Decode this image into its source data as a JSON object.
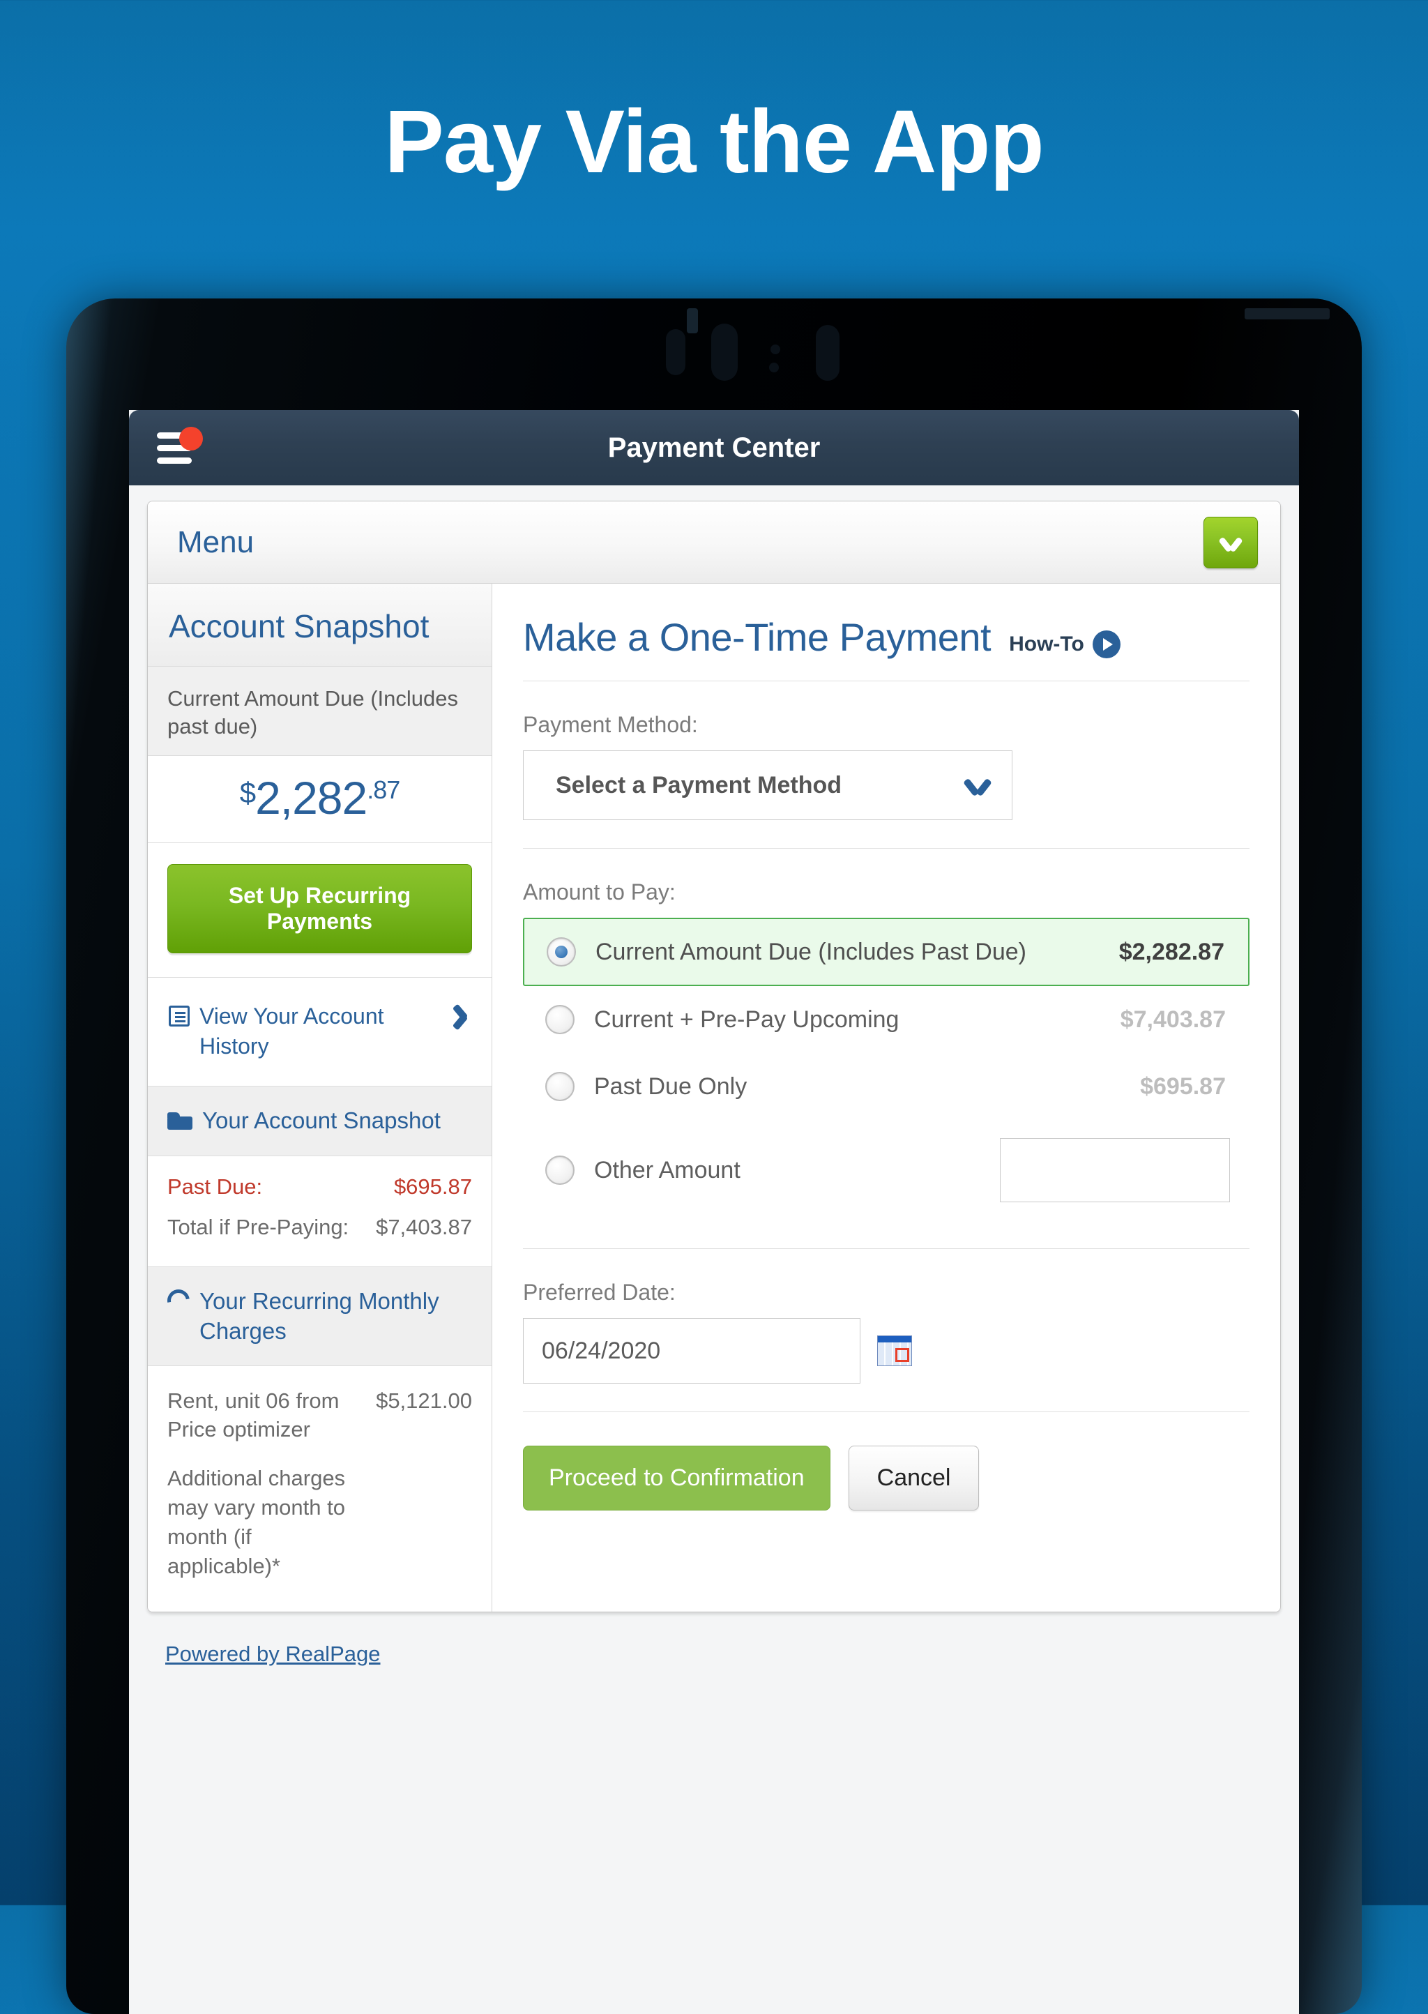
{
  "promo": {
    "headline": "Pay Via the App"
  },
  "appbar": {
    "title": "Payment Center",
    "menu_icon": "hamburger-icon",
    "badge_icon": "notification-dot"
  },
  "menu_strip": {
    "label": "Menu",
    "toggle_icon": "chevron-down-icon"
  },
  "sidebar": {
    "header_title": "Account Snapshot",
    "current_due_label": "Current Amount Due (Includes past due)",
    "current_due_currency": "$",
    "current_due_dollars": "2,282",
    "current_due_cents": ".87",
    "recurring_button": "Set Up Recurring Payments",
    "history_link": "View Your Account History",
    "history_icon": "list-icon",
    "history_chevron": "chevron-right-icon",
    "snapshot_section_title": "Your Account Snapshot",
    "snapshot_icon": "folder-icon",
    "snapshot_rows": [
      {
        "label": "Past Due:",
        "value": "$695.87"
      },
      {
        "label": "Total if Pre-Paying:",
        "value": "$7,403.87"
      }
    ],
    "recurring_section_title": "Your Recurring Monthly Charges",
    "recurring_icon": "refresh-icon",
    "charge_label": "Rent, unit 06 from Price optimizer",
    "charge_value": "$5,121.00",
    "charge_note": "Additional charges may vary month to month (if applicable)*"
  },
  "main": {
    "title": "Make a One-Time Payment",
    "howto_label": "How-To",
    "howto_icon": "play-icon",
    "payment_method_label": "Payment Method:",
    "payment_method_value": "Select a Payment Method",
    "payment_method_icon": "chevron-down-icon",
    "amount_label": "Amount to Pay:",
    "amount_options": [
      {
        "label": "Current Amount Due (Includes Past Due)",
        "amount": "$2,282.87",
        "selected": true
      },
      {
        "label": "Current + Pre-Pay Upcoming",
        "amount": "$7,403.87",
        "selected": false
      },
      {
        "label": "Past Due Only",
        "amount": "$695.87",
        "selected": false
      },
      {
        "label": "Other Amount",
        "amount": "",
        "selected": false
      }
    ],
    "other_amount_value": "",
    "date_label": "Preferred Date:",
    "date_value": "06/24/2020",
    "calendar_icon": "calendar-icon",
    "proceed_button": "Proceed to Confirmation",
    "cancel_button": "Cancel"
  },
  "footer": {
    "powered_by": "Powered by RealPage"
  },
  "colors": {
    "background_top": "#0c79b9",
    "background_bottom": "#05406c",
    "appbar": "#2e4053",
    "accent_blue": "#2a6099",
    "accent_green": "#8bc32c",
    "button_green": "#8cbf4d",
    "danger_red": "#c0392b",
    "badge_red": "#f4422c",
    "selected_row_bg": "#eafaea",
    "selected_row_border": "#4caf50"
  }
}
